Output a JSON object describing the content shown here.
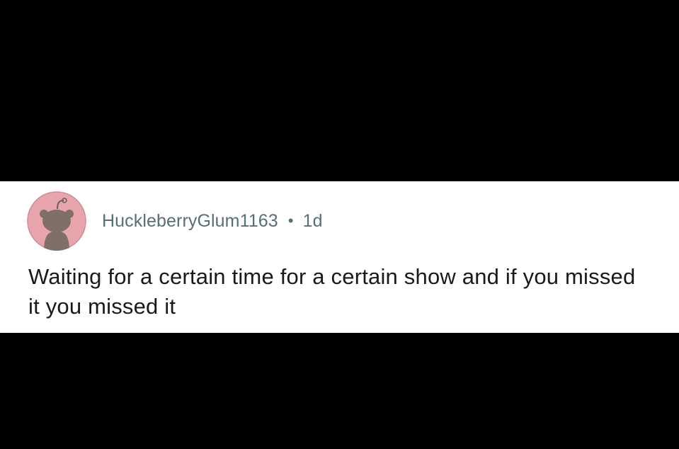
{
  "comment": {
    "author": "HuckleberryGlum1163",
    "separator": "•",
    "age": "1d",
    "text": "Waiting for a certain time for a certain show and if you missed it you missed it",
    "avatar_icon": "reddit-snoo-avatar-icon"
  },
  "colors": {
    "background": "#000000",
    "card": "#ffffff",
    "meta_text": "#576f76",
    "body_text": "#1a1a1b",
    "avatar_bg": "#e8a5ab"
  }
}
